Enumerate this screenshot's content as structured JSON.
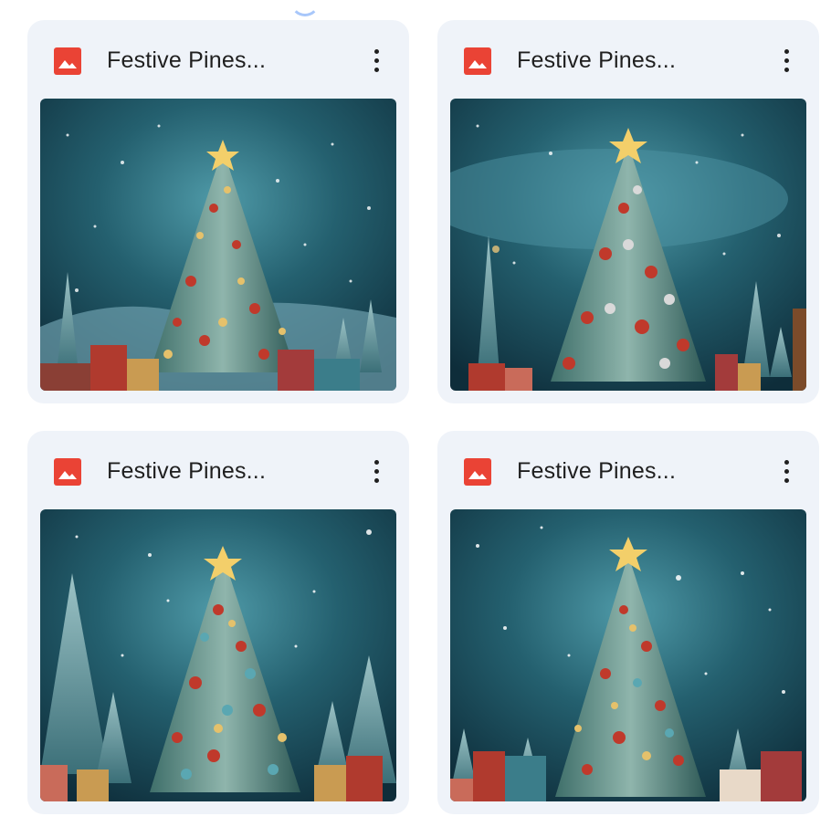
{
  "files": [
    {
      "title": "Festive Pines...",
      "icon": "image-file-icon",
      "menu_icon": "more-vert-icon",
      "thumbnail": "christmas-tree-thumbnail"
    },
    {
      "title": "Festive Pines...",
      "icon": "image-file-icon",
      "menu_icon": "more-vert-icon",
      "thumbnail": "christmas-tree-thumbnail"
    },
    {
      "title": "Festive Pines...",
      "icon": "image-file-icon",
      "menu_icon": "more-vert-icon",
      "thumbnail": "christmas-tree-thumbnail"
    },
    {
      "title": "Festive Pines...",
      "icon": "image-file-icon",
      "menu_icon": "more-vert-icon",
      "thumbnail": "christmas-tree-thumbnail"
    }
  ],
  "colors": {
    "card_bg": "#eff3f9",
    "icon_red": "#ea4335",
    "text": "#1f1f1f",
    "sky": "#1d5a6b"
  }
}
